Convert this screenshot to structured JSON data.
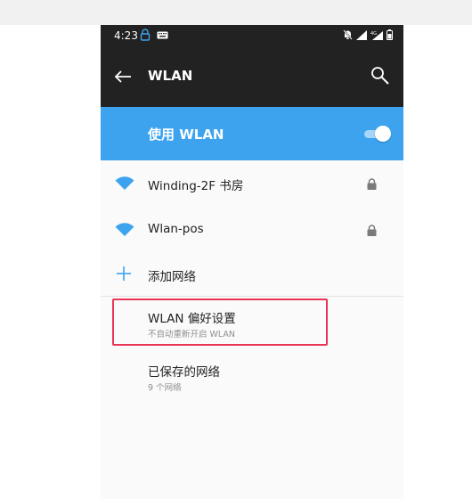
{
  "status_bar": {
    "time": "4:23",
    "left_icons": [
      "vpn-lock-icon",
      "keyboard-icon"
    ],
    "right_icons": [
      "mute-icon",
      "signal-icon",
      "signal-4g-icon",
      "battery-icon"
    ]
  },
  "app_bar": {
    "back_icon": "back-arrow-icon",
    "title": "WLAN",
    "search_icon": "search-icon"
  },
  "wlan_toggle": {
    "label": "使用 WLAN",
    "enabled": true
  },
  "networks": [
    {
      "name": "Winding-2F 书房",
      "icon": "wifi-icon",
      "secured": true
    },
    {
      "name": "Wlan-pos",
      "icon": "wifi-icon",
      "secured": true
    }
  ],
  "add_network": {
    "label": "添加网络",
    "icon": "plus-icon"
  },
  "preferences": {
    "title": "WLAN 偏好设置",
    "subtitle": "不自动重新开启 WLAN"
  },
  "saved_networks": {
    "title": "已保存的网络",
    "subtitle": "9 个网络"
  },
  "colors": {
    "bar_dark": "#222222",
    "accent_blue": "#3da3ef",
    "highlight_red": "#ea3656",
    "background": "#fafafa"
  }
}
